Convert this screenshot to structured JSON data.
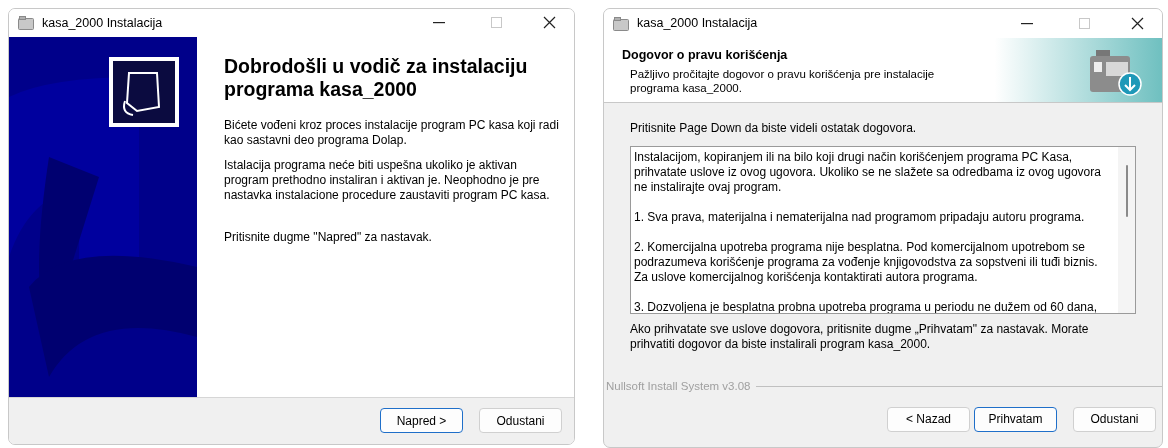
{
  "windows": [
    {
      "kind": "welcome",
      "title": "kasa_2000 Instalacija",
      "heading": "Dobrodošli u vodič za instalaciju programa kasa_2000",
      "paragraphs": [
        "Bićete vođeni kroz proces instalacije program PC kasa koji radi kao sastavni deo programa Dolap.",
        "Istalacija programa neće biti uspešna ukoliko je aktivan program prethodno instaliran i aktivan je. Neophodno je pre nastavka instalacione procedure zaustaviti program PC kasa.",
        "Pritisnite dugme \"Napred\" za nastavak."
      ],
      "buttons": [
        {
          "label": "Napred >",
          "default": true
        },
        {
          "label": "Odustani",
          "default": false
        }
      ]
    },
    {
      "kind": "license",
      "title": "kasa_2000 Instalacija",
      "heading": "Dogovor o pravu korišćenja",
      "subheading": "Pažljivo pročitajte dogovor o pravu korišćenja pre instalacije programa kasa_2000.",
      "hint": "Pritisnite Page Down da biste videli ostatak dogovora.",
      "license_text": [
        "Instalacijom, kopiranjem ili na bilo koji drugi način korišćenjem programa PC Kasa, prihvatate uslove iz ovog ugovora. Ukoliko se ne slažete sa odredbama iz ovog ugovora ne instalirajte ovaj program.",
        "1. Sva prava, materijalna i nematerijalna nad programom pripadaju autoru programa.",
        "2. Komercijalna upotreba programa nije besplatna. Pod komercijalnom upotrebom se podrazumeva korišćenje programa za vođenje knjigovodstva za sopstveni ili tuđi biznis. Za uslove komercijalnog korišćenja kontaktirati autora programa.",
        "3. Dozvoljena je besplatna probna upotreba programa u periodu ne dužem od 60 dana,"
      ],
      "footer_text": "Ako prihvatate sve uslove dogovora, pritisnite dugme „Prihvatam\" za nastavak. Morate prihvatiti dogovor da biste instalirali program kasa_2000.",
      "branding": "Nullsoft Install System v3.08",
      "buttons": [
        {
          "label": "< Nazad",
          "default": false
        },
        {
          "label": "Prihvatam",
          "default": true
        },
        {
          "label": "Odustani",
          "default": false
        }
      ]
    }
  ]
}
